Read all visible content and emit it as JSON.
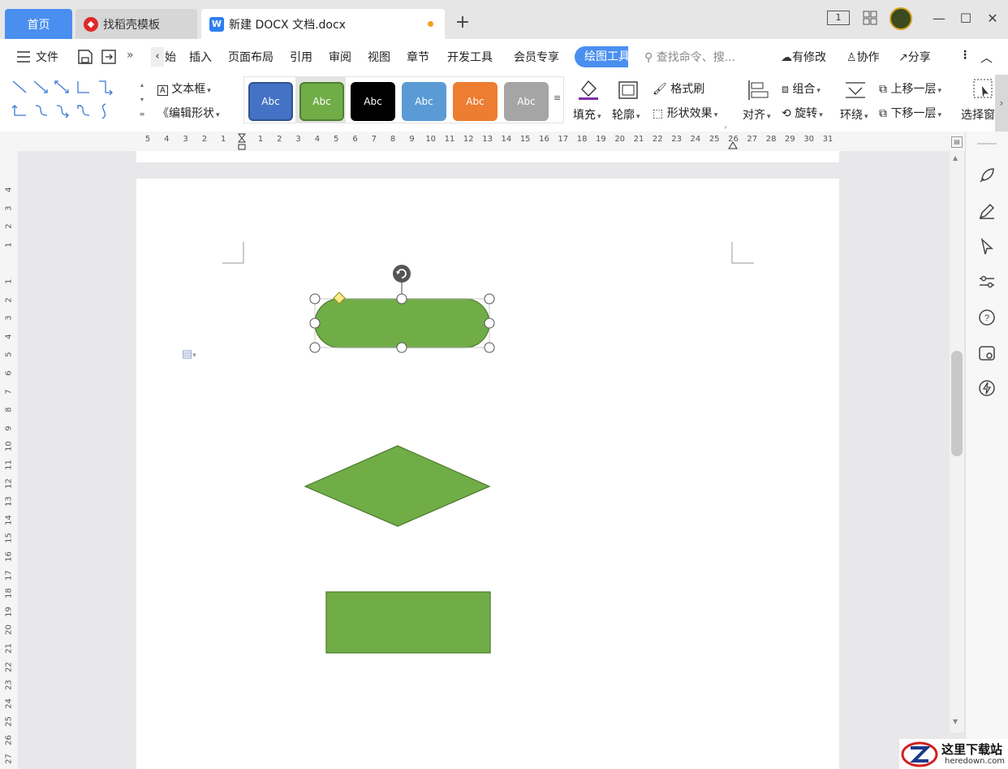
{
  "titlebar": {
    "tab_home": "首页",
    "tab_template": "找稻壳模板",
    "tab_doc": "新建 DOCX 文档.docx",
    "new_tab": "+",
    "page_indicator": "1"
  },
  "menubar": {
    "file": "文件",
    "start_partial": "始",
    "insert": "插入",
    "layout": "页面布局",
    "reference": "引用",
    "review": "审阅",
    "view": "视图",
    "section": "章节",
    "devtools": "开发工具",
    "member": "会员专享",
    "drawing_tools": "绘图工具",
    "search_placeholder": "查找命令、搜...",
    "has_changes": "有修改",
    "collaborate": "协作",
    "share": "分享"
  },
  "ribbon": {
    "textbox": "文本框",
    "edit_shape": "编辑形状",
    "style_label": "Abc",
    "fill": "填充",
    "outline": "轮廓",
    "format_brush": "格式刷",
    "shape_effect": "形状效果",
    "align": "对齐",
    "group": "组合",
    "rotate": "旋转",
    "wrap": "环绕",
    "bring_forward": "上移一层",
    "send_backward": "下移一层",
    "select_pane": "选择窗",
    "colors": {
      "blue": "#4472c4",
      "green": "#70ad47",
      "black": "#000000",
      "lightblue": "#5b9bd5",
      "orange": "#ed7d31",
      "gray": "#a5a5a5"
    }
  },
  "ruler": {
    "h_left": [
      "5",
      "4",
      "3",
      "2",
      "1"
    ],
    "h_right": [
      "1",
      "2",
      "3",
      "4",
      "5",
      "6",
      "7",
      "8",
      "9",
      "10",
      "11",
      "12",
      "13",
      "14",
      "15",
      "16",
      "17",
      "18",
      "19",
      "20",
      "21",
      "22",
      "23",
      "24",
      "25",
      "26",
      "27",
      "28",
      "29",
      "30",
      "31"
    ],
    "v_top": [
      "4",
      "3",
      "2",
      "1"
    ],
    "v_main": [
      "1",
      "2",
      "3",
      "4",
      "5",
      "6",
      "7",
      "8",
      "9",
      "10",
      "11",
      "12",
      "13",
      "14",
      "15",
      "16",
      "17",
      "18",
      "19",
      "20",
      "21",
      "22",
      "23",
      "24",
      "25",
      "26",
      "27"
    ]
  },
  "shapes": {
    "fill_color": "#70ad47",
    "stroke_color": "#507e32"
  },
  "watermark": {
    "title": "这里下载站",
    "url": "heredown.com"
  }
}
